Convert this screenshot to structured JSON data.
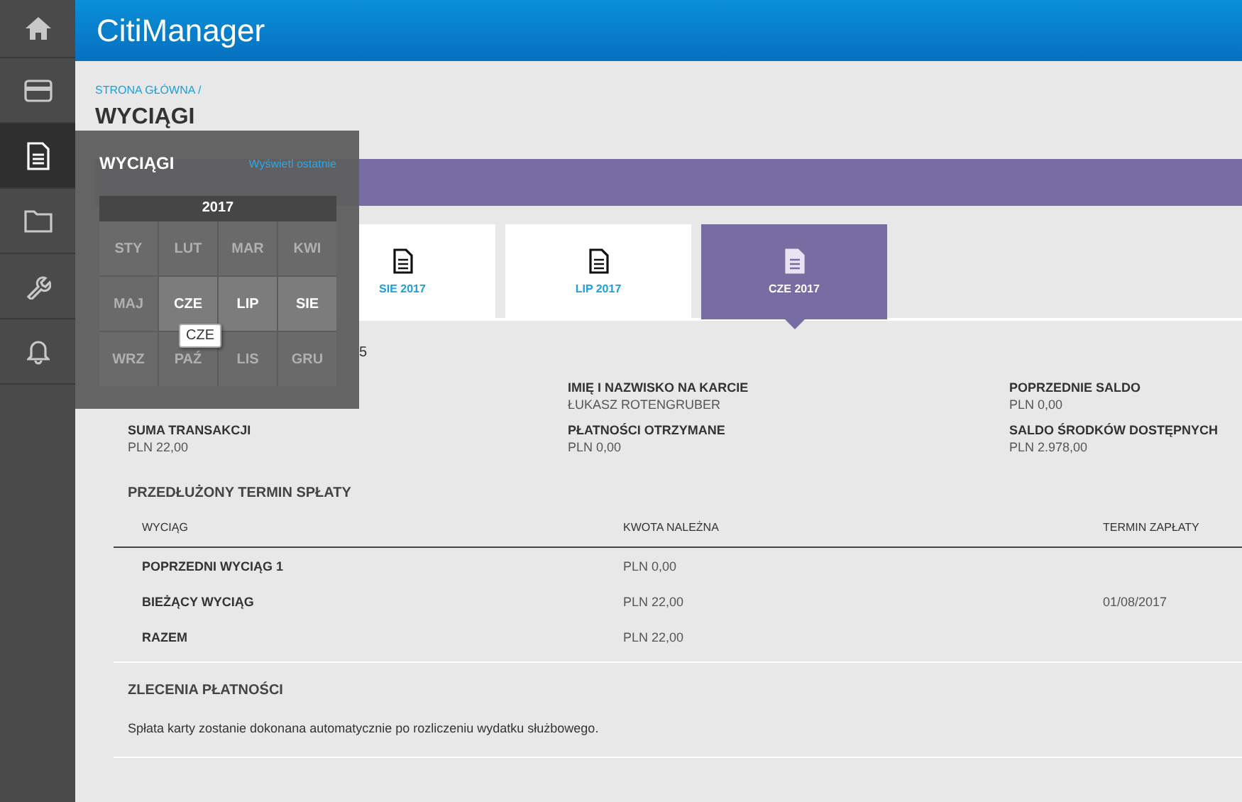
{
  "sidebar": {
    "items": [
      {
        "selected": false
      },
      {
        "selected": false
      },
      {
        "selected": true
      },
      {
        "selected": false
      },
      {
        "selected": false
      },
      {
        "selected": false
      }
    ]
  },
  "header": {
    "title": "CitiManager"
  },
  "breadcrumb": "STRONA GŁÓWNA /",
  "page_title": "WYCIĄGI",
  "statement_cards": [
    {
      "label": "SIE 2017",
      "selected": false
    },
    {
      "label": "LIP 2017",
      "selected": false
    },
    {
      "label": "CZE 2017",
      "selected": true
    }
  ],
  "partial_text": "5",
  "info": [
    {
      "label": "IMIĘ I NAZWISKO NA KARCIE",
      "value": "ŁUKASZ ROTENGRUBER"
    },
    {
      "label": "POPRZEDNIE SALDO",
      "value": "PLN 0,00"
    },
    {
      "label": "SUMA TRANSAKCJI",
      "value": "PLN 22,00"
    },
    {
      "label": "PŁATNOŚCI OTRZYMANE",
      "value": "PLN 0,00"
    },
    {
      "label": "SALDO ŚRODKÓW DOSTĘPNYCH",
      "value": "PLN 2.978,00"
    }
  ],
  "extended_term": {
    "title": "PRZEDŁUŻONY TERMIN SPŁATY",
    "columns": [
      "WYCIĄG",
      "KWOTA NALEŻNA",
      "TERMIN ZAPŁATY"
    ],
    "rows": [
      {
        "cells": [
          "POPRZEDNI WYCIĄG 1",
          "PLN 0,00",
          ""
        ]
      },
      {
        "cells": [
          "BIEŻĄCY WYCIĄG",
          "PLN 22,00",
          "01/08/2017"
        ]
      },
      {
        "cells": [
          "RAZEM",
          "PLN 22,00",
          ""
        ]
      }
    ]
  },
  "payment_orders": {
    "title": "ZLECENIA PŁATNOŚCI",
    "text": "Spłata karty zostanie dokonana automatycznie po rozliczeniu wydatku służbowego."
  },
  "popup": {
    "title": "WYCIĄGI",
    "link": "Wyświetl ostatnie",
    "year": "2017",
    "months": [
      {
        "label": "STY",
        "available": false
      },
      {
        "label": "LUT",
        "available": false
      },
      {
        "label": "MAR",
        "available": false
      },
      {
        "label": "KWI",
        "available": false
      },
      {
        "label": "MAJ",
        "available": false
      },
      {
        "label": "CZE",
        "available": true
      },
      {
        "label": "LIP",
        "available": true
      },
      {
        "label": "SIE",
        "available": true
      },
      {
        "label": "WRZ",
        "available": false
      },
      {
        "label": "PAŹ",
        "available": false
      },
      {
        "label": "LIS",
        "available": false
      },
      {
        "label": "GRU",
        "available": false
      }
    ],
    "tooltip": "CZE"
  }
}
